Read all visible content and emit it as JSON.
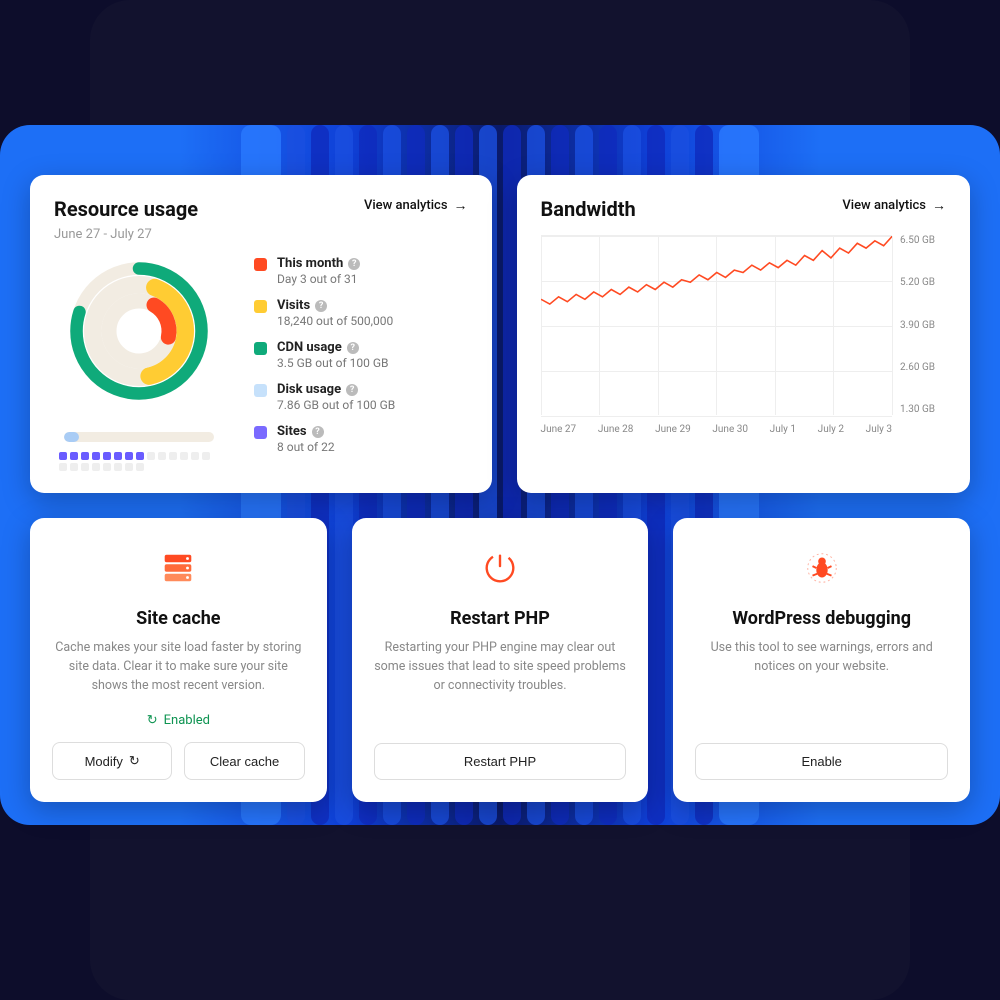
{
  "resource": {
    "title": "Resource usage",
    "date_range": "June 27 - July 27",
    "view_link": "View analytics",
    "legend": [
      {
        "color": "#ff4a22",
        "label": "This month",
        "sub": "Day 3 out of 31"
      },
      {
        "color": "#ffcc33",
        "label": "Visits",
        "sub": "18,240 out of 500,000"
      },
      {
        "color": "#0faa7a",
        "label": "CDN usage",
        "sub": "3.5 GB out of 100 GB"
      },
      {
        "color": "#c6e1fb",
        "label": "Disk usage",
        "sub": "7.86 GB out of 100 GB"
      },
      {
        "color": "#7a6aff",
        "label": "Sites",
        "sub": "8 out of 22"
      }
    ]
  },
  "bandwidth": {
    "title": "Bandwidth",
    "view_link": "View analytics"
  },
  "chart_data": {
    "type": "line",
    "title": "Bandwidth",
    "xlabel": "",
    "ylabel": "",
    "ylim": [
      0,
      6.5
    ],
    "y_ticks": [
      "6.50 GB",
      "5.20 GB",
      "3.90 GB",
      "2.60 GB",
      "1.30 GB"
    ],
    "x_ticks": [
      "June 27",
      "June 28",
      "June 29",
      "June 30",
      "July 1",
      "July 2",
      "July 3"
    ],
    "series": [
      {
        "name": "Bandwidth",
        "color": "#ff4a22",
        "values": [
          3.9,
          3.7,
          4.0,
          3.8,
          4.1,
          3.9,
          4.2,
          4.0,
          4.3,
          4.1,
          4.4,
          4.2,
          4.5,
          4.3,
          4.6,
          4.4,
          4.7,
          4.6,
          4.9,
          4.7,
          5.0,
          4.8,
          5.1,
          5.0,
          5.3,
          5.1,
          5.4,
          5.2,
          5.5,
          5.3,
          5.7,
          5.5,
          5.9,
          5.6,
          6.0,
          5.8,
          6.2,
          6.0,
          6.3,
          6.1,
          6.5
        ]
      }
    ]
  },
  "cards": {
    "cache": {
      "title": "Site cache",
      "desc": "Cache makes your site load faster by storing site data. Clear it to make sure your site shows the most recent version.",
      "status": "Enabled",
      "modify_btn": "Modify",
      "clear_btn": "Clear cache"
    },
    "php": {
      "title": "Restart PHP",
      "desc": "Restarting your PHP engine may clear out some issues that lead to site speed problems or connectivity troubles.",
      "btn": "Restart PHP"
    },
    "debug": {
      "title": "WordPress debugging",
      "desc": "Use this tool to see warnings, errors and notices on your website.",
      "btn": "Enable"
    }
  }
}
